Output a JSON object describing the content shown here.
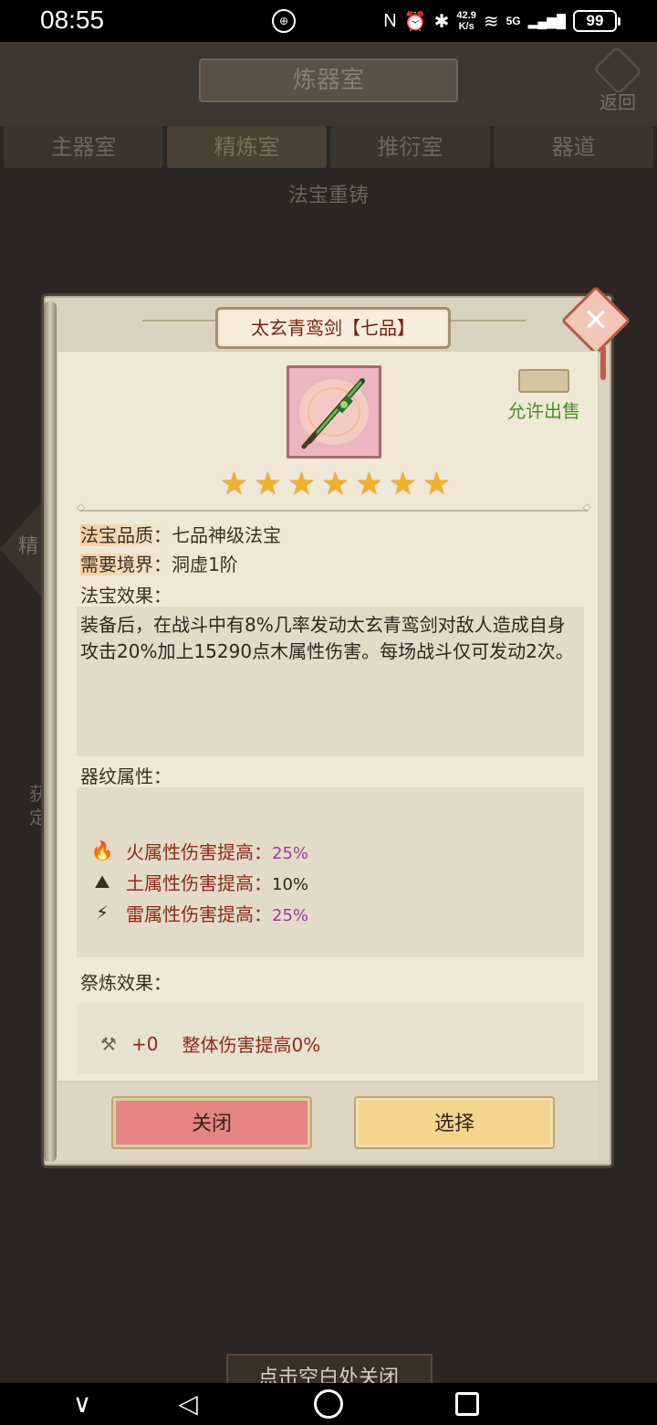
{
  "status_bar": {
    "time": "08:55",
    "center_icon": "⊕",
    "nfc_icon": "N",
    "alarm_icon": "⏰",
    "bluetooth_icon": "✱",
    "net_speed_value": "42.9",
    "net_speed_unit": "K/s",
    "wifi_icon": "≋",
    "network_type": "5G",
    "signal_icon": "▂▄▆█",
    "battery": "99"
  },
  "background": {
    "title": "炼器室",
    "back_label": "返回",
    "tabs": [
      "主器室",
      "精炼室",
      "推衍室",
      "器道"
    ],
    "active_tab": 1,
    "section_title": "法宝重铸",
    "side_label": "精",
    "left_text": "获定"
  },
  "modal": {
    "title": "太玄青鸾剑【七品】",
    "close_glyph": "✕",
    "sale_label": "允许出售",
    "star_count": 7,
    "star_glyph": "★",
    "quality_label": "法宝品质：",
    "quality_value": "七品神级法宝",
    "realm_label": "需要境界：",
    "realm_value": "洞虚1阶",
    "effect_label": "法宝效果：",
    "effect_text": "装备后，在战斗中有8%几率发动太玄青鸾剑对敌人造成自身攻击20%加上15290点木属性伤害。每场战斗仅可发动2次。",
    "pattern_label": "器纹属性：",
    "attributes": [
      {
        "icon": "🔥",
        "name": "火属性伤害提高：",
        "value": "25%",
        "color": "#993d99"
      },
      {
        "icon": "⛰",
        "name": "土属性伤害提高：",
        "value": "10%",
        "color": "#2e2620"
      },
      {
        "icon": "⚡",
        "name": "雷属性伤害提高：",
        "value": "25%",
        "color": "#993d99"
      }
    ],
    "sacrifice_label": "祭炼效果：",
    "sacrifice_icon": "⚒",
    "sacrifice_level": "+0",
    "sacrifice_effect": "整体伤害提高0%",
    "btn_close": "关闭",
    "btn_select": "选择"
  },
  "hint": "点击空白处关闭",
  "nav": {
    "chevron": "∨",
    "back": "◁"
  },
  "colors": {
    "title_red": "#7a1f12",
    "attr_red": "#8e2a1a",
    "sale_green": "#4e8c2c",
    "star_gold": "#f1b12f",
    "btn_close_bg": "#e48583",
    "btn_select_bg": "#f5d48e"
  }
}
